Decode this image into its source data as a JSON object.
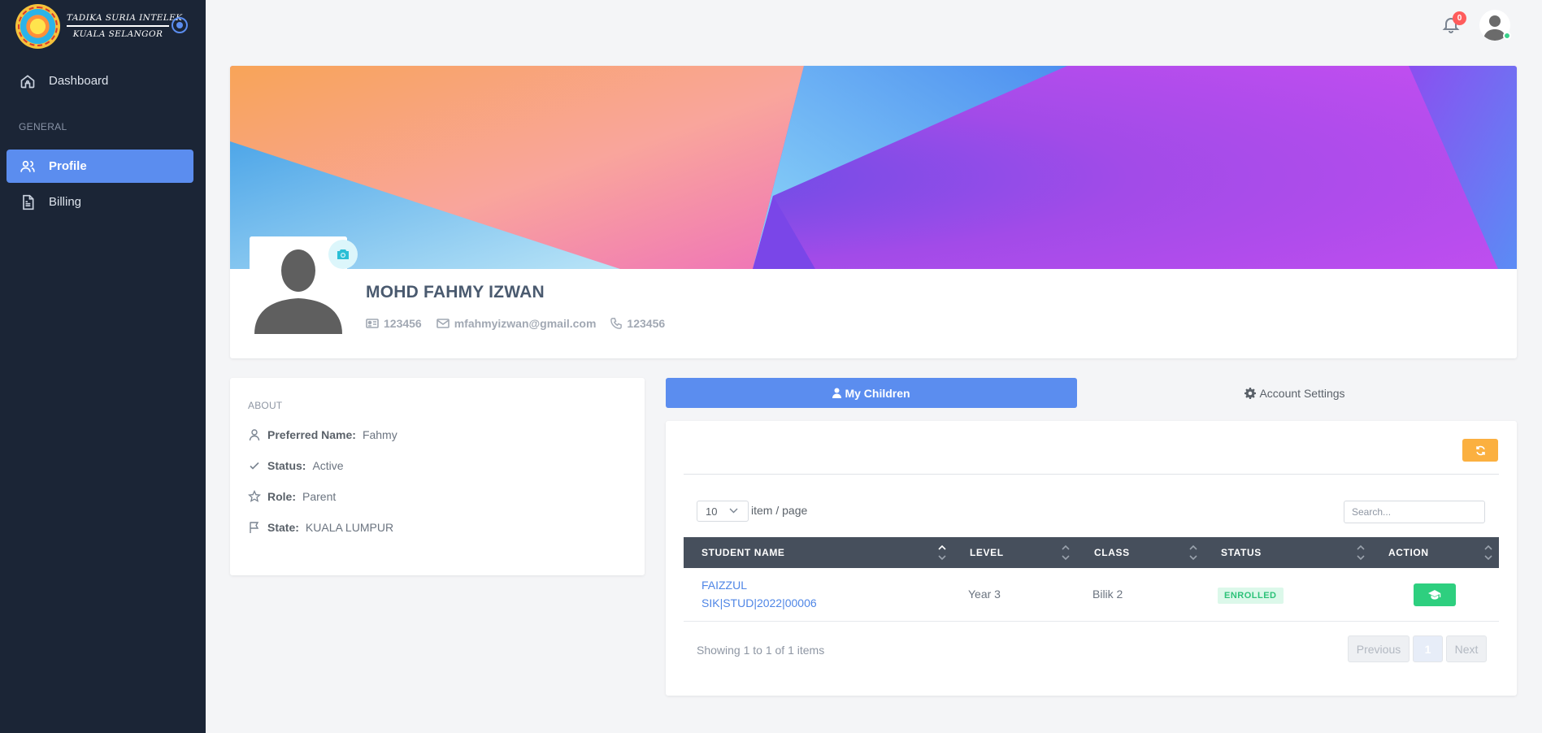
{
  "brand": {
    "line1": "TADIKA SURIA INTELEK",
    "line2": "KUALA SELANGOR"
  },
  "sidebar": {
    "dashboard_label": "Dashboard",
    "section_label": "GENERAL",
    "items": [
      {
        "label": "Profile",
        "icon": "users-icon",
        "active": true
      },
      {
        "label": "Billing",
        "icon": "document-icon",
        "active": false
      }
    ]
  },
  "topbar": {
    "notification_count": "0"
  },
  "profile": {
    "name": "MOHD FAHMY IZWAN",
    "id_number": "123456",
    "email": "mfahmyizwan@gmail.com",
    "phone": "123456"
  },
  "about": {
    "title": "ABOUT",
    "rows": [
      {
        "label": "Preferred Name:",
        "value": "Fahmy",
        "icon": "user-icon"
      },
      {
        "label": "Status:",
        "value": "Active",
        "icon": "check-icon"
      },
      {
        "label": "Role:",
        "value": "Parent",
        "icon": "star-icon"
      },
      {
        "label": "State:",
        "value": "KUALA LUMPUR",
        "icon": "flag-icon"
      }
    ]
  },
  "tabs": {
    "children": "My Children",
    "settings": "Account Settings"
  },
  "table": {
    "per_page": "10",
    "per_page_label": "item / page",
    "search_placeholder": "Search...",
    "columns": [
      "STUDENT NAME",
      "LEVEL",
      "CLASS",
      "STATUS",
      "ACTION"
    ],
    "rows": [
      {
        "name": "FAIZZUL",
        "student_id": "SIK|STUD|2022|00006",
        "level": "Year 3",
        "class": "Bilik 2",
        "status": "ENROLLED"
      }
    ],
    "showing": "Showing 1 to 1 of 1 items",
    "pagination": {
      "previous": "Previous",
      "current": "1",
      "next": "Next"
    }
  },
  "colors": {
    "sidebar": "#1b2536",
    "accent": "#5b8def",
    "warning": "#fbb040",
    "success": "#2ecf7f"
  }
}
